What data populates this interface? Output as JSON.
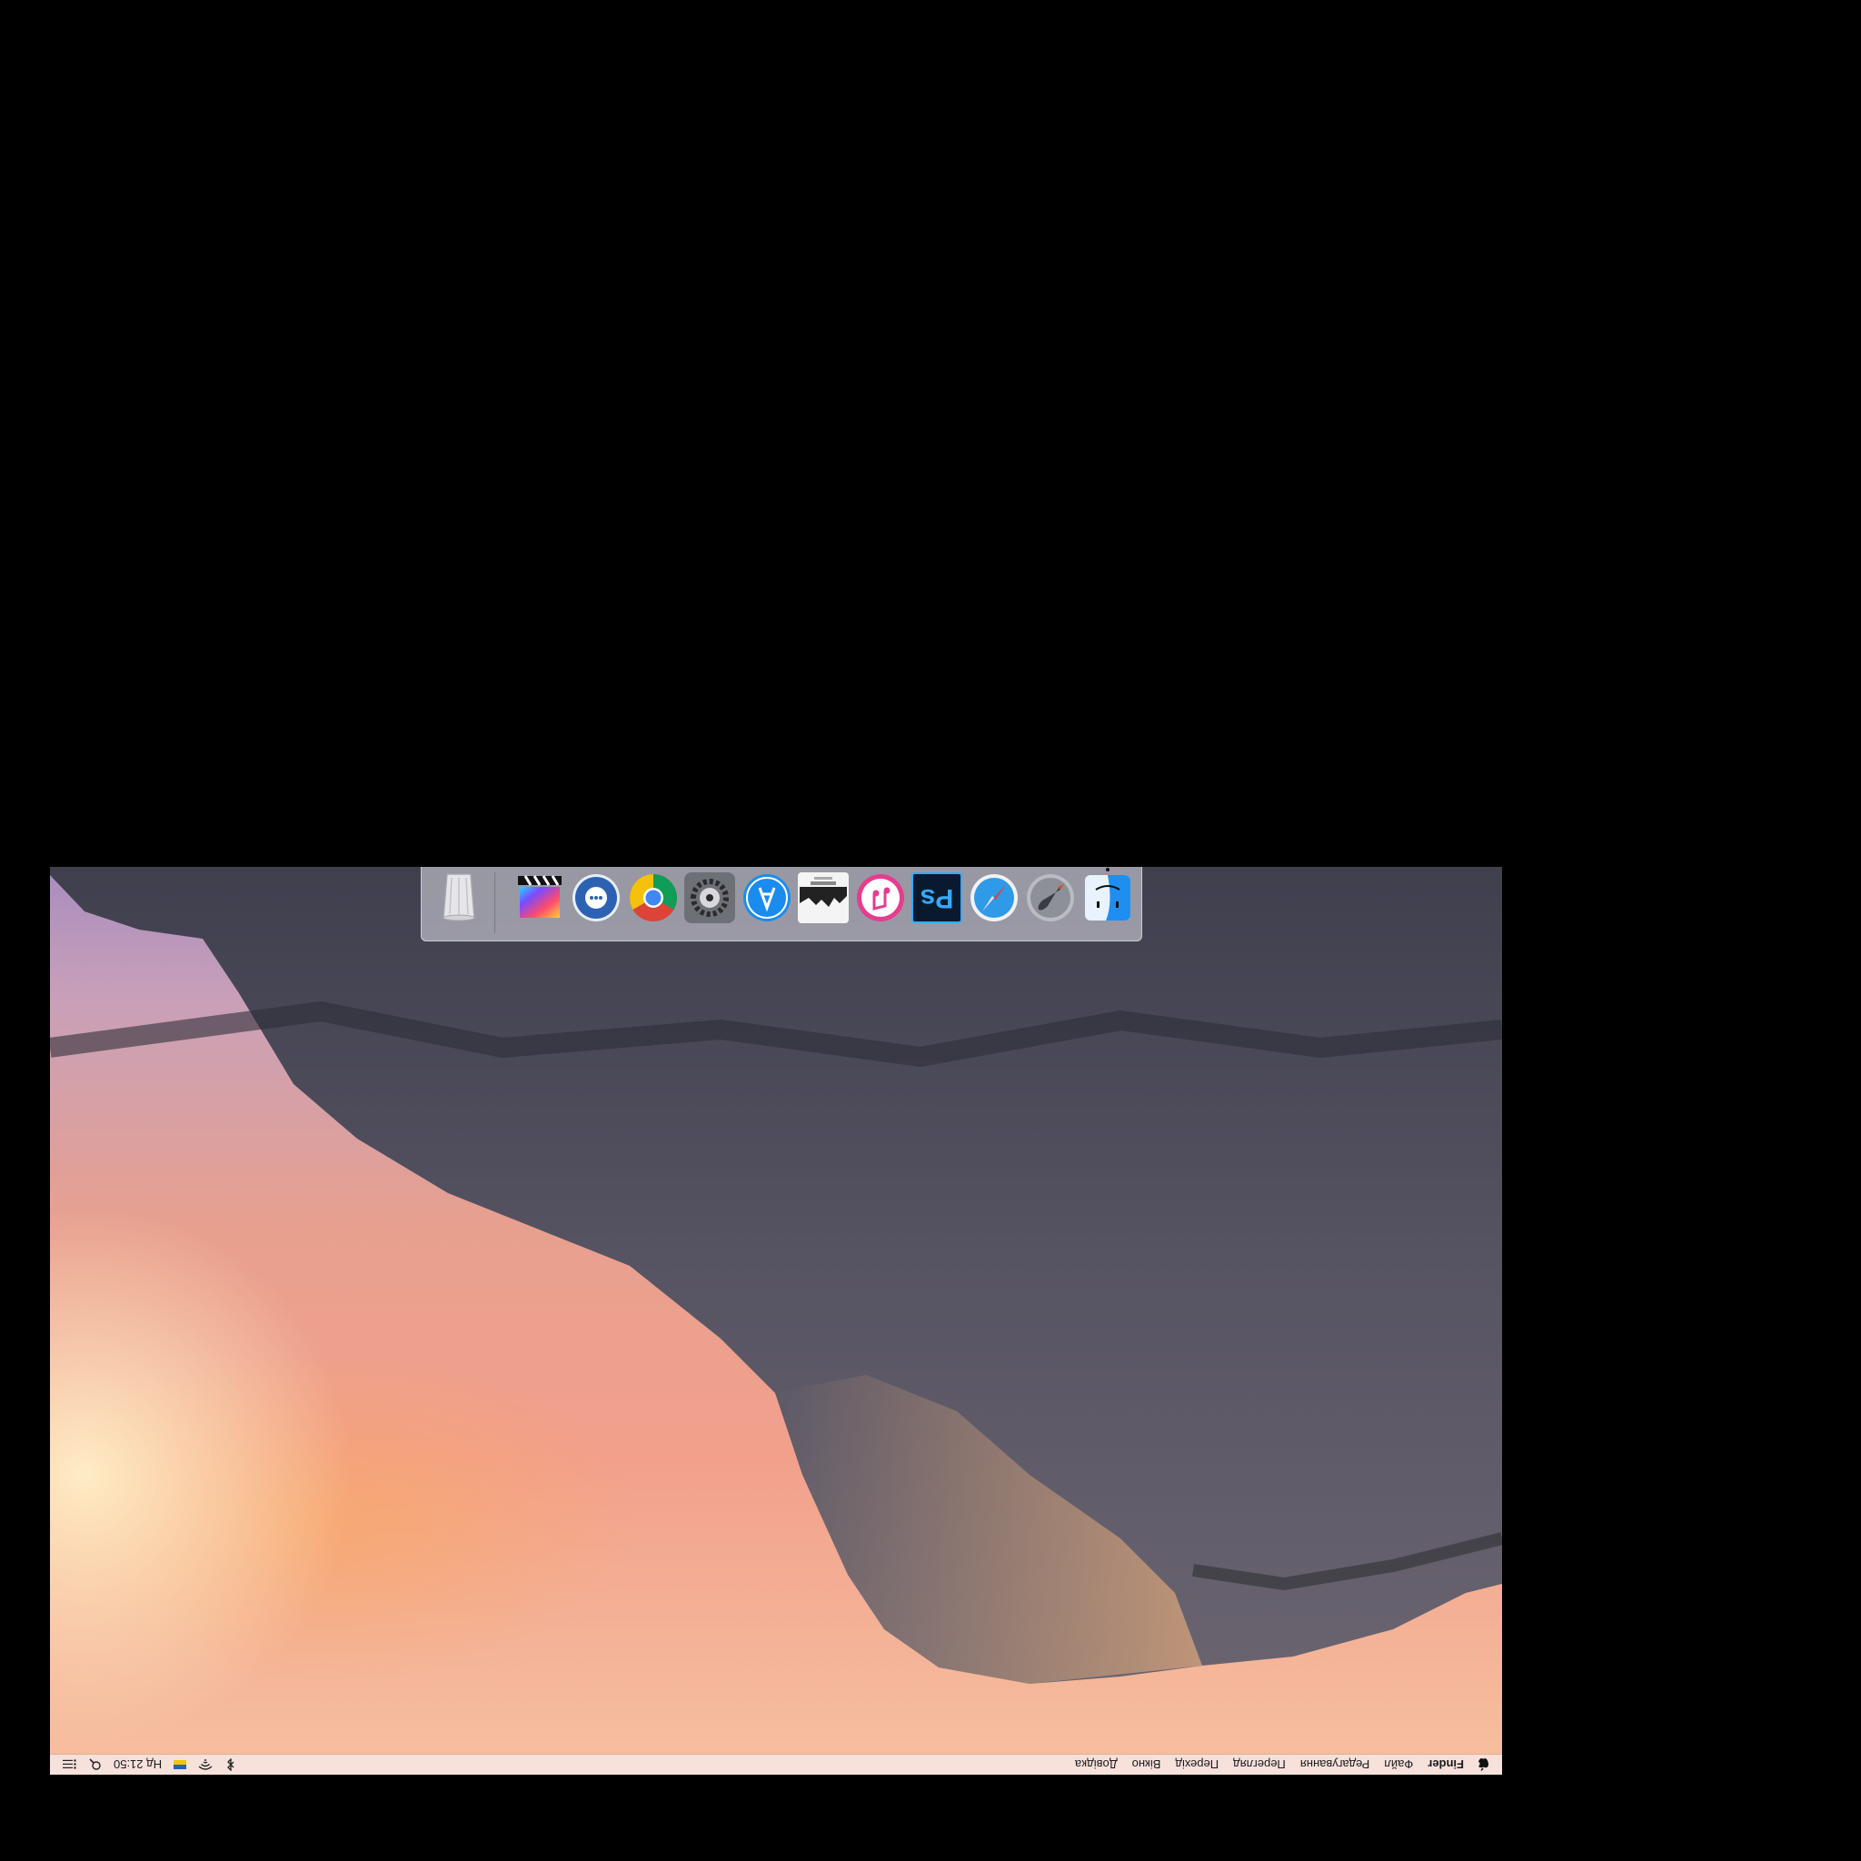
{
  "menubar": {
    "app_name": "Finder",
    "items": [
      "Файл",
      "Редагування",
      "Перегляд",
      "Перехід",
      "Вікно",
      "Довідка"
    ],
    "clock": "Нд 21:50"
  },
  "dock": {
    "apps": [
      {
        "name": "Finder",
        "icon": "finder-icon"
      },
      {
        "name": "Launchpad",
        "icon": "launchpad-rocket-icon"
      },
      {
        "name": "Safari",
        "icon": "safari-compass-icon"
      },
      {
        "name": "Photoshop",
        "icon": "photoshop-icon",
        "label": "Ps"
      },
      {
        "name": "iTunes",
        "icon": "itunes-music-icon"
      },
      {
        "name": "City Album",
        "icon": "album-art-icon"
      },
      {
        "name": "App Store",
        "icon": "app-store-icon"
      },
      {
        "name": "System Preferences",
        "icon": "gear-icon"
      },
      {
        "name": "Chrome",
        "icon": "chrome-icon"
      },
      {
        "name": "Messenger",
        "icon": "chat-bird-icon"
      },
      {
        "name": "Final Cut Pro",
        "icon": "clapperboard-icon"
      },
      {
        "name": "Trash",
        "icon": "trash-icon"
      }
    ]
  },
  "colors": {
    "menubar_bg": "#f5e8e8",
    "sky_top": "#f6c0a0",
    "sky_bottom": "#a98dbf",
    "rock": "#5a5a66"
  }
}
